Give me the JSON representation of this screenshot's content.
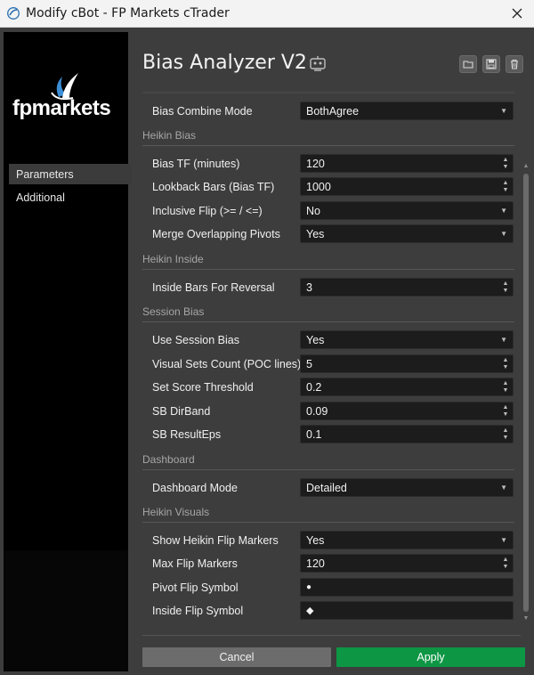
{
  "window": {
    "title": "Modify cBot - FP Markets cTrader",
    "close_icon": "close-icon"
  },
  "sidebar": {
    "logo_text": "fpmarkets",
    "items": [
      {
        "label": "Parameters",
        "active": true
      },
      {
        "label": "Additional",
        "active": false
      }
    ]
  },
  "header": {
    "title": "Bias Analyzer V2",
    "robot_icon": "robot-icon",
    "buttons": [
      "open-folder-icon",
      "save-icon",
      "trash-icon"
    ]
  },
  "params": {
    "bias_combine_mode": {
      "label": "Bias Combine Mode",
      "value": "BothAgree"
    },
    "sections": {
      "heikin_bias": "Heikin Bias",
      "heikin_inside": "Heikin Inside",
      "session_bias": "Session Bias",
      "dashboard": "Dashboard",
      "heikin_visuals": "Heikin Visuals"
    },
    "bias_tf": {
      "label": "Bias TF (minutes)",
      "value": "120"
    },
    "lookback_bars": {
      "label": "Lookback Bars (Bias TF)",
      "value": "1000"
    },
    "inclusive_flip": {
      "label": "Inclusive Flip (>= / <=)",
      "value": "No"
    },
    "merge_pivots": {
      "label": "Merge Overlapping Pivots",
      "value": "Yes"
    },
    "inside_bars": {
      "label": "Inside Bars For Reversal",
      "value": "3"
    },
    "use_session_bias": {
      "label": "Use Session Bias",
      "value": "Yes"
    },
    "visual_sets_count": {
      "label": "Visual Sets Count (POC lines)",
      "value": "5"
    },
    "set_score_threshold": {
      "label": "Set Score Threshold",
      "value": "0.2"
    },
    "sb_dirband": {
      "label": "SB DirBand",
      "value": "0.09"
    },
    "sb_resulteps": {
      "label": "SB ResultEps",
      "value": "0.1"
    },
    "dashboard_mode": {
      "label": "Dashboard Mode",
      "value": "Detailed"
    },
    "show_flip_markers": {
      "label": "Show Heikin Flip Markers",
      "value": "Yes"
    },
    "max_flip_markers": {
      "label": "Max Flip Markers",
      "value": "120"
    },
    "pivot_flip_symbol": {
      "label": "Pivot Flip Symbol",
      "value": "●"
    },
    "inside_flip_symbol": {
      "label": "Inside Flip Symbol",
      "value": "◆"
    }
  },
  "footer": {
    "cancel_label": "Cancel",
    "apply_label": "Apply"
  },
  "colors": {
    "apply": "#0d9644",
    "cancel": "#6c6c6c",
    "background": "#3d3d3d",
    "field": "#1c1c1c"
  }
}
